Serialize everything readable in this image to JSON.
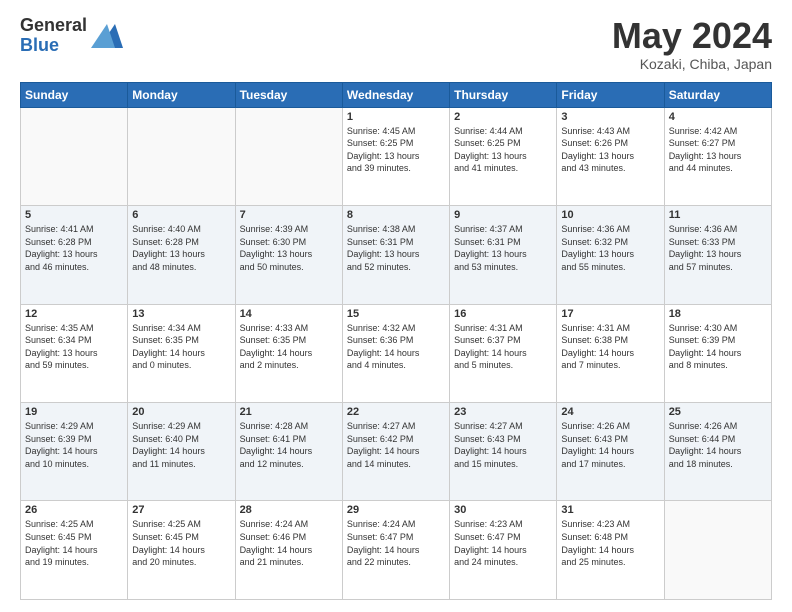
{
  "logo": {
    "general": "General",
    "blue": "Blue"
  },
  "title": "May 2024",
  "location": "Kozaki, Chiba, Japan",
  "days_of_week": [
    "Sunday",
    "Monday",
    "Tuesday",
    "Wednesday",
    "Thursday",
    "Friday",
    "Saturday"
  ],
  "weeks": [
    [
      {
        "day": "",
        "info": ""
      },
      {
        "day": "",
        "info": ""
      },
      {
        "day": "",
        "info": ""
      },
      {
        "day": "1",
        "info": "Sunrise: 4:45 AM\nSunset: 6:25 PM\nDaylight: 13 hours\nand 39 minutes."
      },
      {
        "day": "2",
        "info": "Sunrise: 4:44 AM\nSunset: 6:25 PM\nDaylight: 13 hours\nand 41 minutes."
      },
      {
        "day": "3",
        "info": "Sunrise: 4:43 AM\nSunset: 6:26 PM\nDaylight: 13 hours\nand 43 minutes."
      },
      {
        "day": "4",
        "info": "Sunrise: 4:42 AM\nSunset: 6:27 PM\nDaylight: 13 hours\nand 44 minutes."
      }
    ],
    [
      {
        "day": "5",
        "info": "Sunrise: 4:41 AM\nSunset: 6:28 PM\nDaylight: 13 hours\nand 46 minutes."
      },
      {
        "day": "6",
        "info": "Sunrise: 4:40 AM\nSunset: 6:28 PM\nDaylight: 13 hours\nand 48 minutes."
      },
      {
        "day": "7",
        "info": "Sunrise: 4:39 AM\nSunset: 6:30 PM\nDaylight: 13 hours\nand 50 minutes."
      },
      {
        "day": "8",
        "info": "Sunrise: 4:38 AM\nSunset: 6:31 PM\nDaylight: 13 hours\nand 52 minutes."
      },
      {
        "day": "9",
        "info": "Sunrise: 4:37 AM\nSunset: 6:31 PM\nDaylight: 13 hours\nand 53 minutes."
      },
      {
        "day": "10",
        "info": "Sunrise: 4:36 AM\nSunset: 6:32 PM\nDaylight: 13 hours\nand 55 minutes."
      },
      {
        "day": "11",
        "info": "Sunrise: 4:36 AM\nSunset: 6:33 PM\nDaylight: 13 hours\nand 57 minutes."
      }
    ],
    [
      {
        "day": "12",
        "info": "Sunrise: 4:35 AM\nSunset: 6:34 PM\nDaylight: 13 hours\nand 59 minutes."
      },
      {
        "day": "13",
        "info": "Sunrise: 4:34 AM\nSunset: 6:35 PM\nDaylight: 14 hours\nand 0 minutes."
      },
      {
        "day": "14",
        "info": "Sunrise: 4:33 AM\nSunset: 6:35 PM\nDaylight: 14 hours\nand 2 minutes."
      },
      {
        "day": "15",
        "info": "Sunrise: 4:32 AM\nSunset: 6:36 PM\nDaylight: 14 hours\nand 4 minutes."
      },
      {
        "day": "16",
        "info": "Sunrise: 4:31 AM\nSunset: 6:37 PM\nDaylight: 14 hours\nand 5 minutes."
      },
      {
        "day": "17",
        "info": "Sunrise: 4:31 AM\nSunset: 6:38 PM\nDaylight: 14 hours\nand 7 minutes."
      },
      {
        "day": "18",
        "info": "Sunrise: 4:30 AM\nSunset: 6:39 PM\nDaylight: 14 hours\nand 8 minutes."
      }
    ],
    [
      {
        "day": "19",
        "info": "Sunrise: 4:29 AM\nSunset: 6:39 PM\nDaylight: 14 hours\nand 10 minutes."
      },
      {
        "day": "20",
        "info": "Sunrise: 4:29 AM\nSunset: 6:40 PM\nDaylight: 14 hours\nand 11 minutes."
      },
      {
        "day": "21",
        "info": "Sunrise: 4:28 AM\nSunset: 6:41 PM\nDaylight: 14 hours\nand 12 minutes."
      },
      {
        "day": "22",
        "info": "Sunrise: 4:27 AM\nSunset: 6:42 PM\nDaylight: 14 hours\nand 14 minutes."
      },
      {
        "day": "23",
        "info": "Sunrise: 4:27 AM\nSunset: 6:43 PM\nDaylight: 14 hours\nand 15 minutes."
      },
      {
        "day": "24",
        "info": "Sunrise: 4:26 AM\nSunset: 6:43 PM\nDaylight: 14 hours\nand 17 minutes."
      },
      {
        "day": "25",
        "info": "Sunrise: 4:26 AM\nSunset: 6:44 PM\nDaylight: 14 hours\nand 18 minutes."
      }
    ],
    [
      {
        "day": "26",
        "info": "Sunrise: 4:25 AM\nSunset: 6:45 PM\nDaylight: 14 hours\nand 19 minutes."
      },
      {
        "day": "27",
        "info": "Sunrise: 4:25 AM\nSunset: 6:45 PM\nDaylight: 14 hours\nand 20 minutes."
      },
      {
        "day": "28",
        "info": "Sunrise: 4:24 AM\nSunset: 6:46 PM\nDaylight: 14 hours\nand 21 minutes."
      },
      {
        "day": "29",
        "info": "Sunrise: 4:24 AM\nSunset: 6:47 PM\nDaylight: 14 hours\nand 22 minutes."
      },
      {
        "day": "30",
        "info": "Sunrise: 4:23 AM\nSunset: 6:47 PM\nDaylight: 14 hours\nand 24 minutes."
      },
      {
        "day": "31",
        "info": "Sunrise: 4:23 AM\nSunset: 6:48 PM\nDaylight: 14 hours\nand 25 minutes."
      },
      {
        "day": "",
        "info": ""
      }
    ]
  ]
}
